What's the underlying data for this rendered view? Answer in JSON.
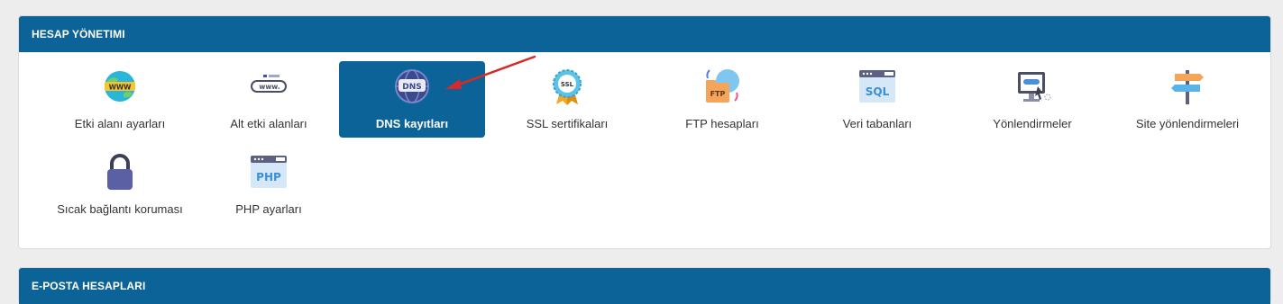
{
  "account_panel": {
    "title": "HESAP YÖNETIMI",
    "items": [
      {
        "label": "Etki alanı ayarları",
        "icon": "www-globe-icon",
        "active": false
      },
      {
        "label": "Alt etki alanları",
        "icon": "subdomain-www-icon",
        "active": false
      },
      {
        "label": "DNS kayıtları",
        "icon": "dns-globe-icon",
        "active": true
      },
      {
        "label": "SSL sertifikaları",
        "icon": "ssl-badge-icon",
        "active": false
      },
      {
        "label": "FTP hesapları",
        "icon": "ftp-folder-icon",
        "active": false
      },
      {
        "label": "Veri tabanları",
        "icon": "sql-database-icon",
        "active": false
      },
      {
        "label": "Yönlendirmeler",
        "icon": "redirect-monitor-icon",
        "active": false
      },
      {
        "label": "Site yönlendirmeleri",
        "icon": "signpost-icon",
        "active": false
      },
      {
        "label": "Sıcak bağlantı koruması",
        "icon": "padlock-icon",
        "active": false
      },
      {
        "label": "PHP ayarları",
        "icon": "php-window-icon",
        "active": false
      }
    ],
    "icon_text": {
      "www": "WWW",
      "subdomain_www": "www.",
      "dns": "DNS",
      "ssl": "SSL",
      "ftp": "FTP",
      "sql": "SQL",
      "php": "PHP"
    }
  },
  "email_panel": {
    "title": "E-POSTA HESAPLARI"
  },
  "colors": {
    "header_bg": "#0c6398",
    "active_tile_bg": "#0c6398",
    "annotation_arrow": "#d42a2a"
  }
}
